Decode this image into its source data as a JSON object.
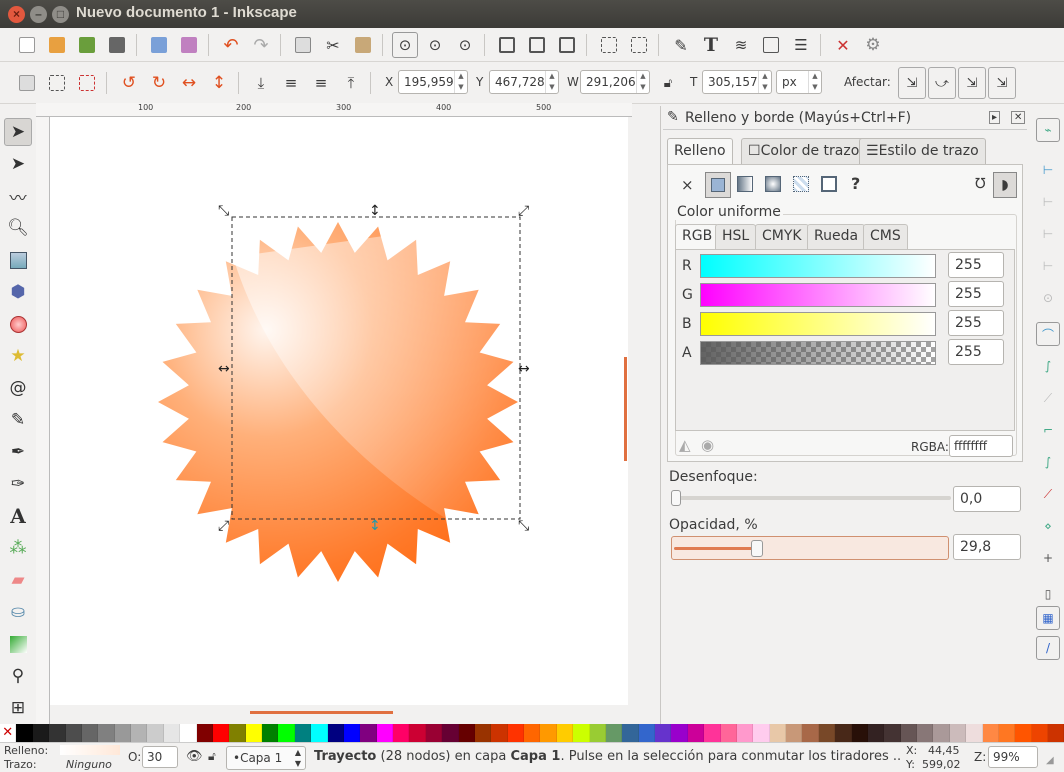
{
  "window": {
    "title": "Nuevo documento 1 - Inkscape"
  },
  "colors": {
    "accent": "#ff7a1a",
    "title_bg": "#3c3b37",
    "panel_bg": "#f2f1f0"
  },
  "toolbar_controls": {
    "x_label": "X",
    "x_value": "195,959",
    "y_label": "Y",
    "y_value": "467,728",
    "w_label": "W",
    "w_value": "291,206",
    "h_label": "T",
    "h_value": "305,157",
    "unit": "px",
    "affect_label": "Afectar:"
  },
  "ruler": {
    "h_ticks": [
      "100",
      "200",
      "300",
      "400",
      "500"
    ]
  },
  "panel": {
    "title": "Relleno y borde (Mayús+Ctrl+F)",
    "tabs": [
      "Relleno",
      "Color de trazo",
      "Estilo de trazo"
    ],
    "fill_type_icons": [
      "x-icon",
      "flat-color-icon",
      "linear-gradient-icon",
      "radial-gradient-icon",
      "pattern-icon",
      "swatch-icon",
      "unset-icon"
    ],
    "uniform_label": "Color uniforme",
    "color_tabs": [
      "RGB",
      "HSL",
      "CMYK",
      "Rueda",
      "CMS"
    ],
    "channels": [
      {
        "label": "R",
        "value": "255"
      },
      {
        "label": "G",
        "value": "255"
      },
      {
        "label": "B",
        "value": "255"
      },
      {
        "label": "A",
        "value": "255"
      }
    ],
    "rgba_label": "RGBA:",
    "rgba_value": "ffffffff",
    "blur_label": "Desenfoque:",
    "blur_value": "0,0",
    "blur_level": 0,
    "opacity_label": "Opacidad, %",
    "opacity_value": "29,8",
    "opacity_level": 29.8
  },
  "status": {
    "fill_label": "Relleno:",
    "stroke_label": "Trazo:",
    "stroke_value": "Ninguno",
    "opacity_label": "O:",
    "opacity_value": "30",
    "layer": "•Capa 1",
    "message_bold": "Trayecto",
    "message_rest": " (28 nodos) en capa ",
    "message_layer": "Capa 1",
    "message_tail": ". Pulse en la selección para conmutar los tiradores ...",
    "x_label": "X:",
    "x_value": "44,45",
    "y_label": "Y:",
    "y_value": "599,02",
    "zoom_label": "Z:",
    "zoom_value": "99%"
  },
  "palette": [
    "#000000",
    "#1a1a1a",
    "#333333",
    "#4d4d4d",
    "#666666",
    "#808080",
    "#999999",
    "#b3b3b3",
    "#cccccc",
    "#e6e6e6",
    "#ffffff",
    "#800000",
    "#ff0000",
    "#808000",
    "#ffff00",
    "#008000",
    "#00ff00",
    "#008080",
    "#00ffff",
    "#000080",
    "#0000ff",
    "#800080",
    "#ff00ff",
    "#ff0066",
    "#cc0033",
    "#990033",
    "#660033",
    "#660000",
    "#993300",
    "#cc3300",
    "#ff3300",
    "#ff6600",
    "#ff9900",
    "#ffcc00",
    "#ccff00",
    "#99cc33",
    "#669966",
    "#336699",
    "#3366cc",
    "#6633cc",
    "#9900cc",
    "#cc0099",
    "#ff3399",
    "#ff6699",
    "#ff99cc",
    "#ffccee",
    "#e8c8a8",
    "#c89878",
    "#a86848",
    "#784828",
    "#482818",
    "#281008",
    "#332222",
    "#443333",
    "#665555",
    "#887777",
    "#aa9999",
    "#ccbbbb",
    "#eedddd",
    "#ff8844",
    "#ff7722",
    "#ff5500",
    "#ee4400",
    "#cc3300"
  ]
}
